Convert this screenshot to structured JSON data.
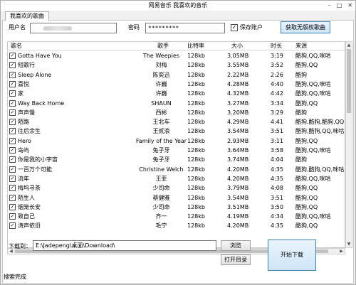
{
  "window": {
    "title": "网易音乐 我喜欢的音乐",
    "controls": {
      "minimize": "–",
      "maximize": "□",
      "close": "✕"
    }
  },
  "tabs": [
    {
      "label": "我喜欢的歌曲"
    }
  ],
  "login": {
    "username_label": "用户名",
    "username_value": "",
    "password_label": "密码",
    "password_value": "*********",
    "remember_label": "保存账户",
    "remember_checked": "✓",
    "fetch_button": "获取无版权歌曲"
  },
  "table": {
    "columns": [
      "歌名",
      "歌手",
      "比特率",
      "大小",
      "时长",
      "来源"
    ],
    "rows": [
      {
        "checked": "✓",
        "title": "Gotta Have You",
        "artist": "The Weepies",
        "bitrate": "128kb",
        "size": "3.05MB",
        "duration": "3:19",
        "source": "酷狗,QQ,咪咕"
      },
      {
        "checked": "✓",
        "title": "短歌行",
        "artist": "刘梅",
        "bitrate": "128kb",
        "size": "3.55MB",
        "duration": "3:52",
        "source": "酷狗,QQ"
      },
      {
        "checked": "✓",
        "title": "Sleep Alone",
        "artist": "陈奕迅",
        "bitrate": "128kb",
        "size": "2.22MB",
        "duration": "2:26",
        "source": "酷狗"
      },
      {
        "checked": "✓",
        "title": "喜悦",
        "artist": "许巍",
        "bitrate": "128kb",
        "size": "4.28MB",
        "duration": "4:40",
        "source": "酷狗,QQ,咪咕"
      },
      {
        "checked": "✓",
        "title": "家",
        "artist": "许巍",
        "bitrate": "128kb",
        "size": "4.32MB",
        "duration": "4:42",
        "source": "酷狗,QQ,咪咕"
      },
      {
        "checked": "✓",
        "title": "Way Back Home",
        "artist": "SHAUN",
        "bitrate": "128kb",
        "size": "3.27MB",
        "duration": "3:34",
        "source": "酷狗,QQ"
      },
      {
        "checked": "✓",
        "title": "声声慢",
        "artist": "西彬",
        "bitrate": "128kb",
        "size": "3.20MB",
        "duration": "3:29",
        "source": "酷狗"
      },
      {
        "checked": "✓",
        "title": "陌路",
        "artist": "王北车",
        "bitrate": "128kb",
        "size": "4.29MB",
        "duration": "4:41",
        "source": "酷狗,酷狗,酷狗,QQ,咪咕"
      },
      {
        "checked": "✓",
        "title": "往后余生",
        "artist": "王贰浪",
        "bitrate": "128kb",
        "size": "3.54MB",
        "duration": "3:51",
        "source": "酷狗,酷狗,QQ,咪咕"
      },
      {
        "checked": "✓",
        "title": "Hero",
        "artist": "Family of the Year",
        "bitrate": "128kb",
        "size": "2.93MB",
        "duration": "3:11",
        "source": "酷狗,QQ"
      },
      {
        "checked": "✓",
        "title": "岛屿",
        "artist": "兔子牙",
        "bitrate": "128kb",
        "size": "3.64MB",
        "duration": "3:58",
        "source": "酷狗,QQ,咪咕"
      },
      {
        "checked": "✓",
        "title": "你是我的小宇宙",
        "artist": "兔子牙",
        "bitrate": "128kb",
        "size": "3.74MB",
        "duration": "4:04",
        "source": "酷狗"
      },
      {
        "checked": "✓",
        "title": "一百万个可能",
        "artist": "Christine Welch",
        "bitrate": "128kb",
        "size": "4.20MB",
        "duration": "4:35",
        "source": "酷狗,酷狗,QQ,咪咕"
      },
      {
        "checked": "✓",
        "title": "流年",
        "artist": "王菲",
        "bitrate": "128kb",
        "size": "4.20MB",
        "duration": "4:35",
        "source": "酷狗,QQ,咪咕"
      },
      {
        "checked": "✓",
        "title": "梅坞寻茶",
        "artist": "少司命",
        "bitrate": "128kb",
        "size": "3.79MB",
        "duration": "4:08",
        "source": "酷狗,QQ"
      },
      {
        "checked": "✓",
        "title": "陌生人",
        "artist": "蔡健雅",
        "bitrate": "128kb",
        "size": "3.54MB",
        "duration": "3:51",
        "source": "酷狗,QQ"
      },
      {
        "checked": "✓",
        "title": "烟笼长安",
        "artist": "少司命",
        "bitrate": "128kb",
        "size": "3.51MB",
        "duration": "3:50",
        "source": "酷狗,QQ"
      },
      {
        "checked": "✓",
        "title": "致自己",
        "artist": "齐一",
        "bitrate": "128kb",
        "size": "4.19MB",
        "duration": "4:34",
        "source": "酷狗,QQ,咪咕"
      },
      {
        "checked": "✓",
        "title": "涛声依旧",
        "artist": "毛宁",
        "bitrate": "128kb",
        "size": "4.20MB",
        "duration": "4:35",
        "source": "酷狗,QQ"
      }
    ]
  },
  "download": {
    "path_label": "下载到：",
    "path_value": "E:\\Jadepeng\\桌面\\Download\\",
    "browse_button": "浏览",
    "open_folder_button": "打开目录",
    "start_button": "开始下载"
  },
  "status": {
    "text": "搜索完成"
  },
  "icons": {
    "scroll_up": "▲",
    "scroll_down": "▼",
    "scroll_left": "◀",
    "scroll_right": "▶"
  }
}
